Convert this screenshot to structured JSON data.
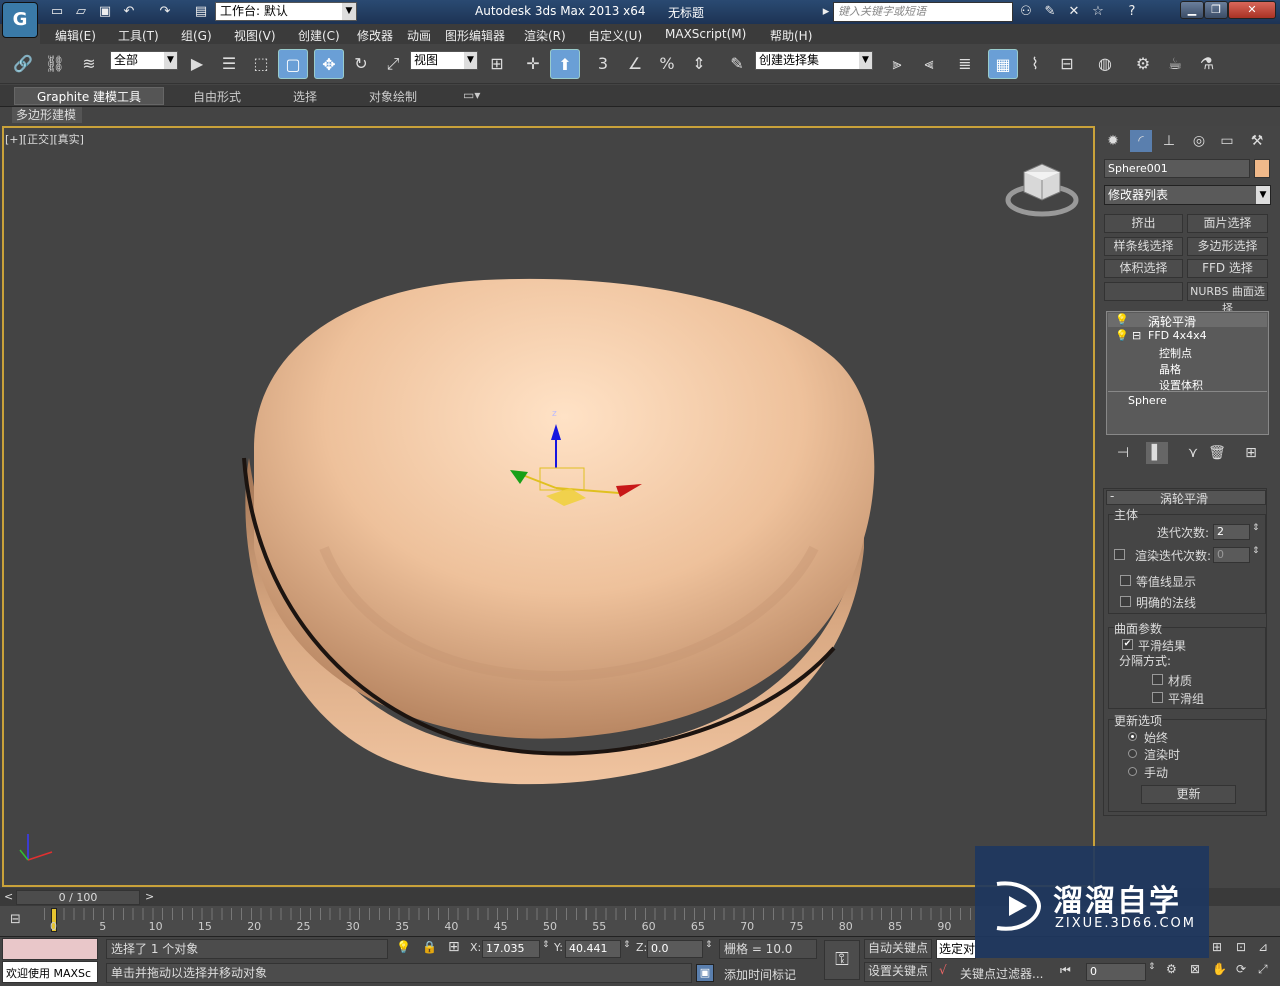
{
  "app": {
    "logo": "G",
    "workspace_label": "工作台: 默认",
    "title": "Autodesk 3ds Max  2013 x64",
    "doc_title": "无标题",
    "search_placeholder": "键入关键字或短语"
  },
  "menu": [
    "编辑(E)",
    "工具(T)",
    "组(G)",
    "视图(V)",
    "创建(C)",
    "修改器",
    "动画",
    "图形编辑器",
    "渲染(R)",
    "自定义(U)",
    "MAXScript(M)",
    "帮助(H)"
  ],
  "toolbar": {
    "selection_filter": "全部",
    "ref_coord": "视图",
    "selection_set": "创建选择集"
  },
  "ribbon": {
    "tabs": [
      "Graphite 建模工具",
      "自由形式",
      "选择",
      "对象绘制"
    ],
    "subtab": "多边形建模"
  },
  "viewport": {
    "label": "[+][正交][真实]"
  },
  "panel": {
    "object_name": "Sphere001",
    "object_color": "#f0b98a",
    "modifier_list": "修改器列表",
    "modifier_buttons": [
      "挤出",
      "面片选择",
      "样条线选择",
      "多边形选择",
      "体积选择",
      "FFD 选择",
      "",
      "NURBS 曲面选择"
    ],
    "stack": {
      "turbosmooth": "涡轮平滑",
      "ffd": "FFD 4x4x4",
      "ffd_children": [
        "控制点",
        "晶格",
        "设置体积"
      ],
      "base": "Sphere"
    },
    "rollout_title": "涡轮平滑",
    "main_group": "主体",
    "iterations_label": "迭代次数:",
    "iterations_value": "2",
    "render_iters_label": "渲染迭代次数:",
    "render_iters_value": "0",
    "isoline_label": "等值线显示",
    "explicit_normals_label": "明确的法线",
    "surface_group": "曲面参数",
    "smooth_result_label": "平滑结果",
    "separate_by_label": "分隔方式:",
    "materials_label": "材质",
    "smoothing_groups_label": "平滑组",
    "update_group": "更新选项",
    "always_label": "始终",
    "when_render_label": "渲染时",
    "manual_label": "手动",
    "update_button": "更新"
  },
  "timeline": {
    "frame_counter": "0 / 100",
    "ticks": [
      "0",
      "5",
      "10",
      "15",
      "20",
      "25",
      "30",
      "35",
      "40",
      "45",
      "50",
      "55",
      "60",
      "65",
      "70",
      "75",
      "80",
      "85",
      "90"
    ]
  },
  "status": {
    "script_label": "欢迎使用 MAXSc",
    "selected_text": "选择了 1 个对象",
    "prompt_text": "单击并拖动以选择并移动对象",
    "x_label": "X:",
    "x_value": "17.035",
    "y_label": "Y:",
    "y_value": "40.441",
    "z_label": "Z:",
    "z_value": "0.0",
    "grid_text": "栅格 = 10.0",
    "add_time_tag": "添加时间标记",
    "auto_key": "自动关键点",
    "set_key": "设置关键点",
    "selected_combo": "选定对",
    "key_filters": "关键点过滤器...",
    "frame_value": "0"
  },
  "watermark": {
    "brand": "溜溜自学",
    "url": "ZIXUE.3D66.COM"
  }
}
